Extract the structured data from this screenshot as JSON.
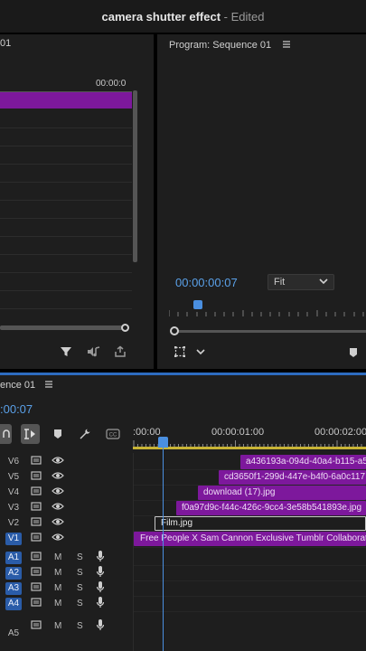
{
  "window": {
    "app_title": "camera shutter effect",
    "separator": " - ",
    "status": "Edited"
  },
  "source_panel": {
    "tab_partial": "01",
    "ruler_time": "00:00:0"
  },
  "program_monitor": {
    "title": "Program: Sequence 01",
    "menu_icon": "hamburger-icon",
    "timecode": "00:00:00:07",
    "fit_label": "Fit"
  },
  "timeline": {
    "tab_label": "ence 01",
    "timecode": ":00:07",
    "ruler_labels": [
      ":00:00",
      "00:00:01:00",
      "00:00:02:00"
    ],
    "tracks": [
      {
        "name": "V6",
        "type": "video"
      },
      {
        "name": "V5",
        "type": "video"
      },
      {
        "name": "V4",
        "type": "video"
      },
      {
        "name": "V3",
        "type": "video"
      },
      {
        "name": "V2",
        "type": "video"
      },
      {
        "name": "V1",
        "type": "video",
        "targeted": true
      },
      {
        "name": "A1",
        "type": "audio",
        "targeted": true
      },
      {
        "name": "A2",
        "type": "audio",
        "targeted": true
      },
      {
        "name": "A3",
        "type": "audio",
        "targeted": true
      },
      {
        "name": "A4",
        "type": "audio",
        "targeted": true
      },
      {
        "name": "A5",
        "type": "audio"
      }
    ],
    "audio_buttons": {
      "mute": "M",
      "solo": "S"
    },
    "clips": [
      {
        "track": "V6",
        "label": "a436193a-094d-40a4-b115-a5"
      },
      {
        "track": "V5",
        "label": "cd3650f1-299d-447e-b4f0-6a0c117"
      },
      {
        "track": "V4",
        "label": "download (17).jpg"
      },
      {
        "track": "V3",
        "label": "f0a97d9c-f44c-426c-9cc4-3e58b541893e.jpg"
      },
      {
        "track": "V2",
        "label": "Film.jpg"
      },
      {
        "track": "V1",
        "label": "Free People X Sam Cannon Exclusive Tumblr Collaboration"
      }
    ]
  },
  "colors": {
    "clip_purple": "#7d189c",
    "timecode_blue": "#5aa0e8",
    "track_target_blue": "#2a5ca8",
    "work_area_yellow": "#c8b435"
  }
}
